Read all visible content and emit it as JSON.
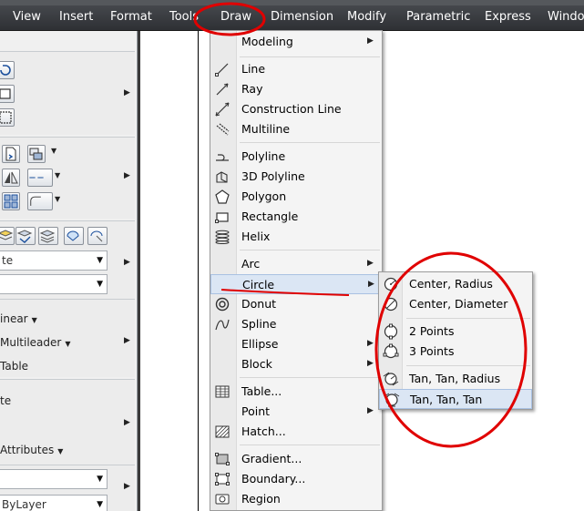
{
  "menubar": {
    "items": [
      {
        "label": "View"
      },
      {
        "label": "Insert"
      },
      {
        "label": "Format"
      },
      {
        "label": "Tools"
      },
      {
        "label": "Draw"
      },
      {
        "label": "Dimension"
      },
      {
        "label": "Modify"
      },
      {
        "label": "Parametric"
      },
      {
        "label": "Express"
      },
      {
        "label": "Windo"
      }
    ]
  },
  "left_panel": {
    "combo1": "te",
    "combo2": "",
    "linear": "inear",
    "multileader": "Multileader",
    "table": "Table",
    "te2": "te",
    "attributes": "Attributes",
    "combo3": "",
    "bylayer": "ByLayer"
  },
  "draw_menu": {
    "items": [
      {
        "label": "Modeling",
        "icon": "none",
        "submenu": true
      },
      {
        "label": "Line",
        "icon": "line-icon"
      },
      {
        "label": "Ray",
        "icon": "ray-icon"
      },
      {
        "label": "Construction Line",
        "icon": "construction-line-icon"
      },
      {
        "label": "Multiline",
        "icon": "multiline-icon"
      },
      {
        "label": "Polyline",
        "icon": "polyline-icon"
      },
      {
        "label": "3D Polyline",
        "icon": "3d-polyline-icon"
      },
      {
        "label": "Polygon",
        "icon": "polygon-icon"
      },
      {
        "label": "Rectangle",
        "icon": "rectangle-icon"
      },
      {
        "label": "Helix",
        "icon": "helix-icon"
      },
      {
        "label": "Arc",
        "icon": "none",
        "submenu": true
      },
      {
        "label": "Circle",
        "icon": "none",
        "submenu": true,
        "highlighted": true
      },
      {
        "label": "Donut",
        "icon": "donut-icon"
      },
      {
        "label": "Spline",
        "icon": "spline-icon"
      },
      {
        "label": "Ellipse",
        "icon": "none",
        "submenu": true
      },
      {
        "label": "Block",
        "icon": "none",
        "submenu": true
      },
      {
        "label": "Table...",
        "icon": "table-icon"
      },
      {
        "label": "Point",
        "icon": "none",
        "submenu": true
      },
      {
        "label": "Hatch...",
        "icon": "hatch-icon"
      },
      {
        "label": "Gradient...",
        "icon": "gradient-icon"
      },
      {
        "label": "Boundary...",
        "icon": "boundary-icon"
      },
      {
        "label": "Region",
        "icon": "region-icon"
      }
    ]
  },
  "circle_menu": {
    "items": [
      {
        "label": "Center, Radius",
        "icon": "circle-center-radius-icon"
      },
      {
        "label": "Center, Diameter",
        "icon": "circle-center-diameter-icon"
      },
      {
        "label": "2 Points",
        "icon": "circle-2-points-icon"
      },
      {
        "label": "3 Points",
        "icon": "circle-3-points-icon"
      },
      {
        "label": "Tan, Tan, Radius",
        "icon": "circle-tan-tan-radius-icon"
      },
      {
        "label": "Tan, Tan, Tan",
        "icon": "circle-tan-tan-tan-icon",
        "highlighted": true
      }
    ]
  },
  "colors": {
    "menubar": "#3c3f44",
    "highlight": "#dbe6f4",
    "annotation": "#e00000"
  }
}
